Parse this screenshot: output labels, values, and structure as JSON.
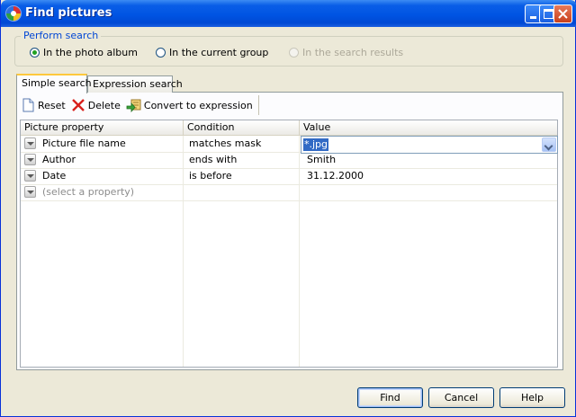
{
  "window": {
    "title": "Find pictures"
  },
  "perform_search": {
    "legend": "Perform search",
    "options": [
      {
        "label": "In the photo album",
        "selected": true,
        "enabled": true
      },
      {
        "label": "In the current group",
        "selected": false,
        "enabled": true
      },
      {
        "label": "In the search results",
        "selected": false,
        "enabled": false
      }
    ]
  },
  "tabs": [
    {
      "label": "Simple search",
      "active": true
    },
    {
      "label": "Expression search",
      "active": false
    }
  ],
  "toolbar": {
    "reset_label": "Reset",
    "delete_label": "Delete",
    "convert_label": "Convert to expression"
  },
  "grid": {
    "columns": [
      "Picture property",
      "Condition",
      "Value"
    ],
    "rows": [
      {
        "property": "Picture file name",
        "condition": "matches mask",
        "value": "*.jpg",
        "editing": true
      },
      {
        "property": "Author",
        "condition": "ends with",
        "value": "Smith"
      },
      {
        "property": "Date",
        "condition": "is before",
        "value": "31.12.2000"
      }
    ],
    "new_row_placeholder": "(select a property)"
  },
  "buttons": {
    "find": "Find",
    "cancel": "Cancel",
    "help": "Help"
  },
  "colors": {
    "titlebar": "#0054e3",
    "group_legend": "#0046d5",
    "selection": "#316ac5",
    "active_tab_accent": "#ffc83c"
  }
}
